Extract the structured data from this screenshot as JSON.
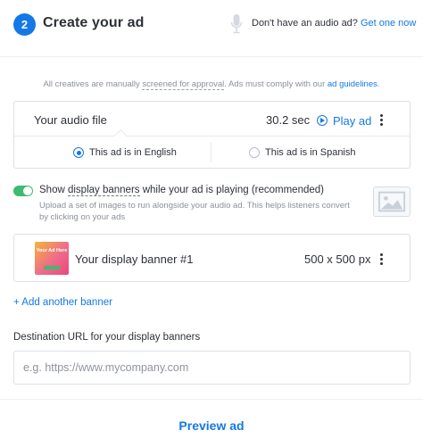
{
  "header": {
    "step_number": "2",
    "title": "Create your ad",
    "no_audio_text": "Don't have an audio ad?",
    "get_one_link": "Get one now"
  },
  "disclaimer": {
    "prefix": "All creatives are manually ",
    "screened_link": "screened for approval",
    "middle": ". Ads must comply with our ",
    "guidelines_link": "ad guidelines",
    "suffix": "."
  },
  "audio_file": {
    "label": "Your audio file",
    "duration": "30.2 sec",
    "play_label": "Play ad",
    "languages": [
      {
        "label": "This ad is in English",
        "selected": true
      },
      {
        "label": "This ad is in Spanish",
        "selected": false
      }
    ]
  },
  "display_banners": {
    "toggle_on": true,
    "label_prefix": "Show ",
    "label_link": "display banners",
    "label_suffix": " while your ad is playing (recommended)",
    "help_text": "Upload a set of images to run alongside your audio ad. This helps listeners convert by clicking on your ads",
    "banners": [
      {
        "thumb_text": "Your Ad Here",
        "name": "Your display banner #1",
        "size": "500 x 500 px"
      }
    ],
    "add_label": "+ Add another banner"
  },
  "destination": {
    "label": "Destination URL for your display banners",
    "value": "",
    "placeholder": "e.g. https://www.mycompany.com"
  },
  "footer": {
    "preview_label": "Preview ad"
  },
  "colors": {
    "accent": "#1479e6",
    "toggle_on": "#3dbb6e",
    "border": "#dde1e6"
  },
  "icons": [
    "microphone-icon",
    "play-circle-icon",
    "more-vertical-icon",
    "image-placeholder-icon"
  ]
}
